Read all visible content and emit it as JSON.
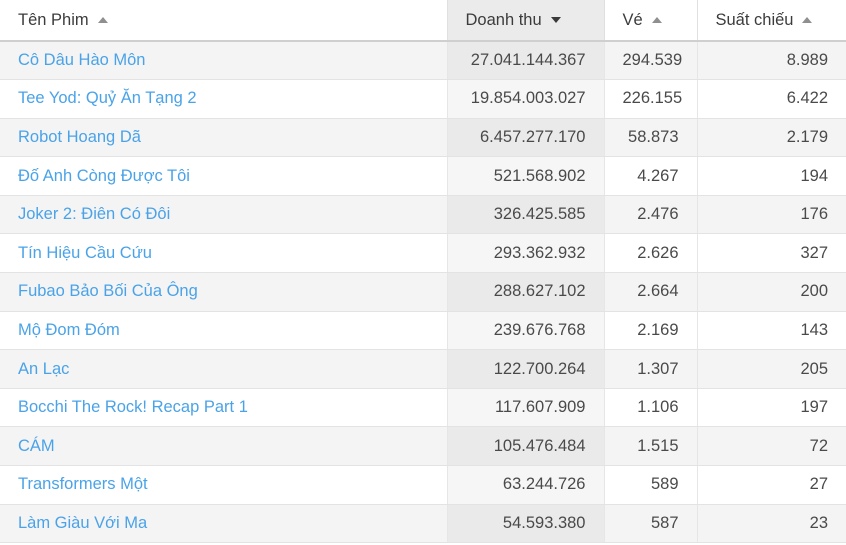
{
  "table": {
    "columns": [
      {
        "key": "title",
        "label": "Tên Phim",
        "sort": "asc",
        "active": false,
        "align": "left"
      },
      {
        "key": "revenue",
        "label": "Doanh thu",
        "sort": "desc",
        "active": true,
        "align": "right"
      },
      {
        "key": "tickets",
        "label": "Vé",
        "sort": "asc",
        "active": false,
        "align": "right"
      },
      {
        "key": "shows",
        "label": "Suất chiếu",
        "sort": "asc",
        "active": false,
        "align": "right"
      }
    ],
    "rows": [
      {
        "title": "Cô Dâu Hào Môn",
        "revenue": "27.041.144.367",
        "tickets": "294.539",
        "shows": "8.989"
      },
      {
        "title": "Tee Yod: Quỷ Ăn Tạng 2",
        "revenue": "19.854.003.027",
        "tickets": "226.155",
        "shows": "6.422"
      },
      {
        "title": "Robot Hoang Dã",
        "revenue": "6.457.277.170",
        "tickets": "58.873",
        "shows": "2.179"
      },
      {
        "title": "Đố Anh Còng Được Tôi",
        "revenue": "521.568.902",
        "tickets": "4.267",
        "shows": "194"
      },
      {
        "title": "Joker 2: Điên Có Đôi",
        "revenue": "326.425.585",
        "tickets": "2.476",
        "shows": "176"
      },
      {
        "title": "Tín Hiệu Cầu Cứu",
        "revenue": "293.362.932",
        "tickets": "2.626",
        "shows": "327"
      },
      {
        "title": "Fubao Bảo Bối Của Ông",
        "revenue": "288.627.102",
        "tickets": "2.664",
        "shows": "200"
      },
      {
        "title": "Mộ Đom Đóm",
        "revenue": "239.676.768",
        "tickets": "2.169",
        "shows": "143"
      },
      {
        "title": "An Lạc",
        "revenue": "122.700.264",
        "tickets": "1.307",
        "shows": "205"
      },
      {
        "title": "Bocchi The Rock! Recap Part 1",
        "revenue": "117.607.909",
        "tickets": "1.106",
        "shows": "197"
      },
      {
        "title": "CÁM",
        "revenue": "105.476.484",
        "tickets": "1.515",
        "shows": "72"
      },
      {
        "title": "Transformers Một",
        "revenue": "63.244.726",
        "tickets": "589",
        "shows": "27"
      },
      {
        "title": "Làm Giàu Với Ma",
        "revenue": "54.593.380",
        "tickets": "587",
        "shows": "23"
      }
    ]
  },
  "colors": {
    "link": "#4aa3e8",
    "text": "#4a4a4a",
    "header_text": "#3c3c3c",
    "sorted_header_bg": "#ebebeb",
    "stripe_bg": "#f4f4f4",
    "sorted_col_stripe_bg": "#eaeaea",
    "arrow_active": "#3a3a3a",
    "arrow_inactive": "#8f8f8f"
  }
}
